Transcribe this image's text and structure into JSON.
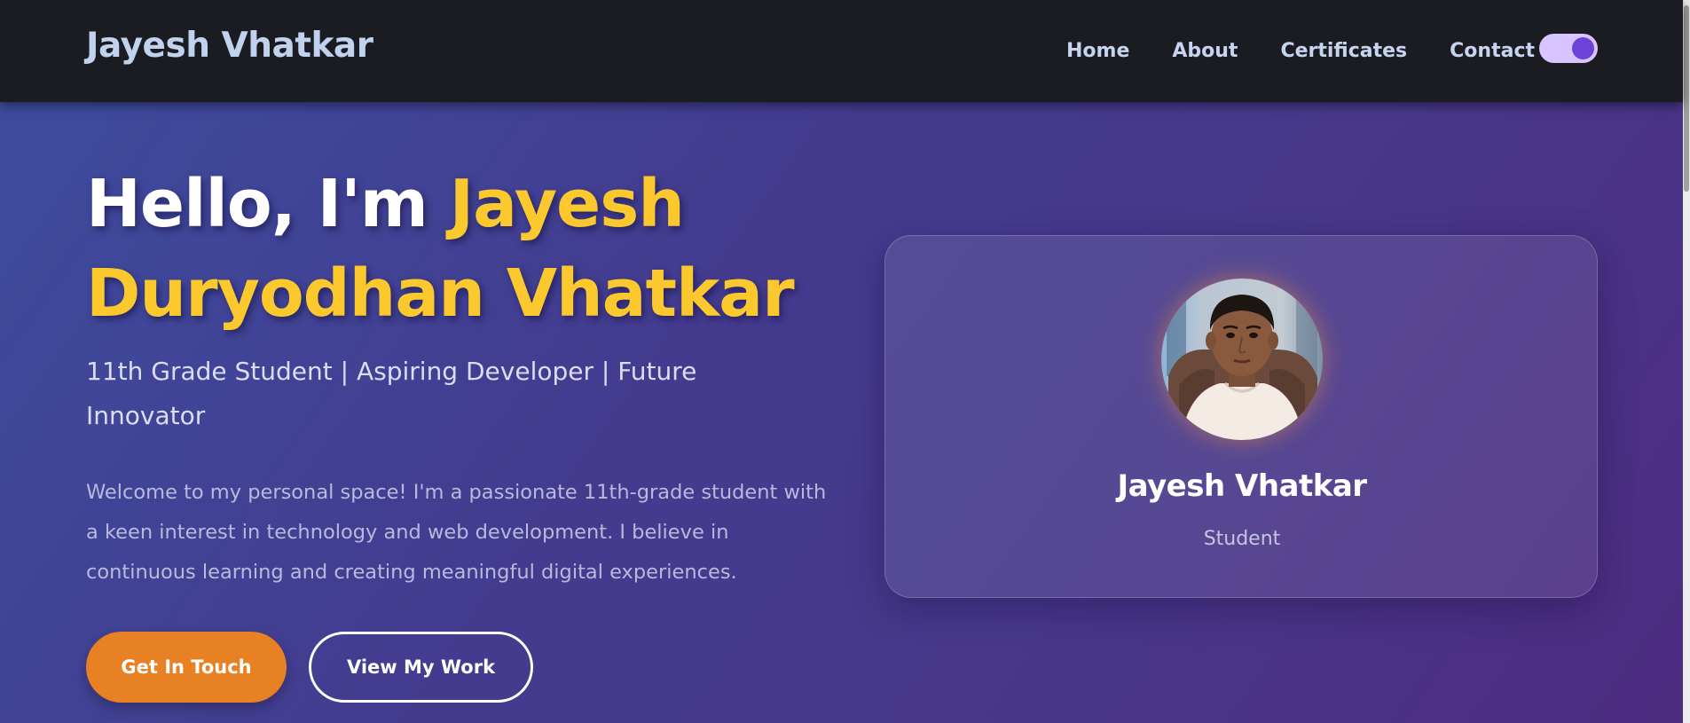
{
  "navbar": {
    "brand": "Jayesh Vhatkar",
    "links": [
      {
        "label": "Home"
      },
      {
        "label": "About"
      },
      {
        "label": "Certificates"
      },
      {
        "label": "Contact"
      }
    ],
    "theme_toggle": {
      "state": "on",
      "icon": "toggle-switch",
      "track_color": "#d8c4ff",
      "knob_color": "#6c43d6"
    }
  },
  "hero": {
    "title_prefix": "Hello, I'm ",
    "title_highlight": "Jayesh Duryodhan Vhatkar",
    "subtitle": "11th Grade Student | Aspiring Developer | Future Innovator",
    "intro": "Welcome to my personal space! I'm a passionate 11th-grade student with a keen interest in technology and web development. I believe in continuous learning and creating meaningful digital experiences.",
    "primary_button": "Get In Touch",
    "secondary_button": "View My Work"
  },
  "profile_card": {
    "name": "Jayesh Vhatkar",
    "role": "Student",
    "avatar": "profile-photo"
  },
  "colors": {
    "accent_yellow": "#fbc82e",
    "accent_orange": "#e88123",
    "nav_background": "#1b1c21",
    "hero_gradient_start": "#3d4c9d",
    "hero_gradient_end": "#4d2c80"
  }
}
